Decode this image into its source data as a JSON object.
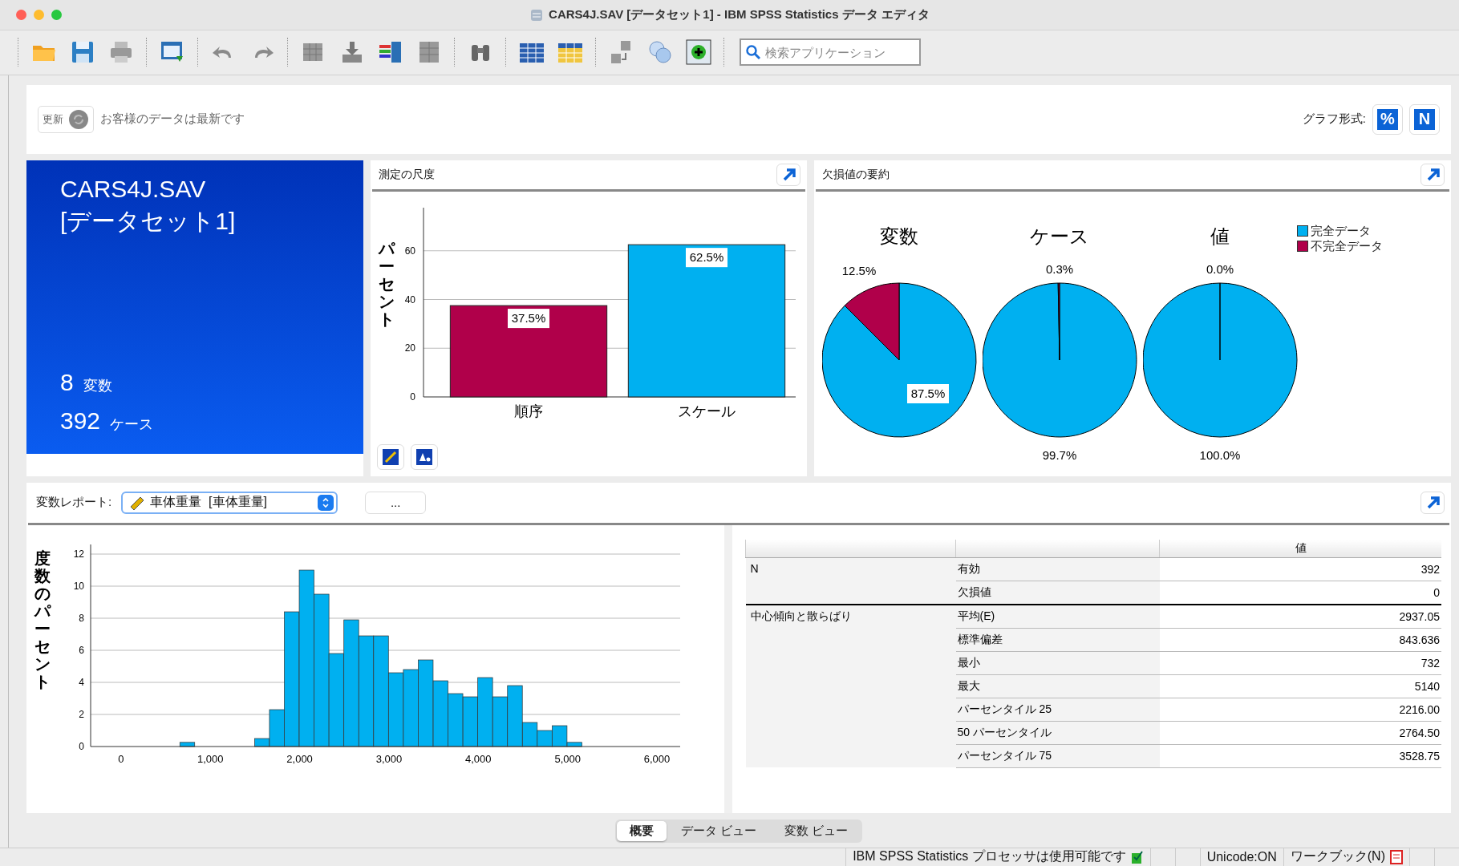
{
  "window": {
    "title": "CARS4J.SAV [データセット1] - IBM SPSS Statistics データ エディタ"
  },
  "toolbar": {
    "search": {
      "placeholder": "検索アプリケーション"
    }
  },
  "header": {
    "refresh_label": "更新",
    "status": "お客様のデータは最新です",
    "graph_format_label": "グラフ形式:",
    "format_buttons": [
      "%",
      "N"
    ]
  },
  "dataset_card": {
    "title": "CARS4J.SAV",
    "subtitle": "[データセット1]",
    "stats": [
      {
        "number": "8",
        "label": "変数"
      },
      {
        "number": "392",
        "label": "ケース"
      }
    ]
  },
  "measurement_panel": {
    "title": "測定の尺度",
    "chart_data": {
      "type": "bar",
      "ylabel": "パーセント",
      "ylim": [
        0,
        77.7
      ],
      "yticks": [
        0,
        20,
        40,
        60
      ],
      "grid": true,
      "series": [
        {
          "name": "順序",
          "color": "#b0004a",
          "values": [
            37.5,
            null
          ]
        },
        {
          "name": "スケール",
          "color": "#00b0f0",
          "values": [
            null,
            62.5
          ]
        }
      ],
      "value_labels": [
        "37.5%",
        "62.5%"
      ]
    }
  },
  "missing_panel": {
    "title": "欠損値の要約",
    "legend": [
      {
        "label": "完全データ",
        "color": "#00b0f0"
      },
      {
        "label": "不完全データ",
        "color": "#b0004a"
      }
    ],
    "pies": [
      {
        "chart_data": {
          "type": "pie",
          "title": "変数",
          "values": [
            87.5,
            12.5
          ],
          "value_labels": [
            "87.5%",
            "12.5%"
          ]
        }
      },
      {
        "chart_data": {
          "type": "pie",
          "title": "ケース",
          "values": [
            99.7,
            0.3
          ],
          "value_labels": [
            "99.7%",
            "0.3%"
          ]
        }
      },
      {
        "chart_data": {
          "type": "pie",
          "title": "値",
          "values": [
            100.0,
            0.0
          ],
          "value_labels": [
            "100.0%",
            "0.0%"
          ]
        }
      }
    ]
  },
  "variable_report": {
    "label": "変数レポート:",
    "selected_variable": "車体重量  [車体重量]",
    "more_button": "...",
    "chart_data": {
      "type": "bar",
      "ylabel": "度数のパーセント",
      "x": [
        742,
        1578,
        1745,
        1911,
        2078,
        2245,
        2411,
        2578,
        2745,
        2911,
        3078,
        3244,
        3411,
        3578,
        3744,
        3911,
        4077,
        4244,
        4410,
        4577,
        4743,
        4910,
        5077
      ],
      "values": [
        0.26,
        0.5,
        2.3,
        8.4,
        11.0,
        9.5,
        5.8,
        7.9,
        6.9,
        6.9,
        4.6,
        4.8,
        5.4,
        4.1,
        3.3,
        3.1,
        4.3,
        3.1,
        3.8,
        1.5,
        1.0,
        1.3,
        0.26
      ],
      "xlim": [
        -340,
        6260
      ],
      "ylim": [
        0,
        12.6
      ],
      "grid": true,
      "xticks": [
        {
          "value": 0,
          "label": "0"
        },
        {
          "value": 1000,
          "label": "1,000"
        },
        {
          "value": 2000,
          "label": "2,000"
        },
        {
          "value": 3000,
          "label": "3,000"
        },
        {
          "value": 4000,
          "label": "4,000"
        },
        {
          "value": 5000,
          "label": "5,000"
        },
        {
          "value": 6000,
          "label": "6,000"
        }
      ],
      "yticks": [
        0,
        2,
        4,
        6,
        8,
        10,
        12
      ]
    },
    "table": {
      "value_header": "値",
      "groups": [
        {
          "label": "N",
          "rows": [
            {
              "stat": "有効",
              "value": "392"
            },
            {
              "stat": "欠損値",
              "value": "0"
            }
          ]
        },
        {
          "label": "中心傾向と散らばり",
          "rows": [
            {
              "stat": "平均(E)",
              "value": "2937.05"
            },
            {
              "stat": "標準偏差",
              "value": "843.636"
            },
            {
              "stat": "最小",
              "value": "732"
            },
            {
              "stat": "最大",
              "value": "5140"
            },
            {
              "stat": "パーセンタイル 25",
              "value": "2216.00"
            },
            {
              "stat": "50 パーセンタイル",
              "value": "2764.50"
            },
            {
              "stat": "パーセンタイル 75",
              "value": "3528.75"
            }
          ]
        }
      ]
    }
  },
  "view_tabs": [
    {
      "label": "概要",
      "selected": true
    },
    {
      "label": "データ ビュー",
      "selected": false
    },
    {
      "label": "変数 ビュー",
      "selected": false
    }
  ],
  "status_bar": {
    "processor": "IBM SPSS Statistics プロセッサは使用可能です",
    "unicode": "Unicode:ON",
    "workbook": "ワークブック(N)"
  }
}
